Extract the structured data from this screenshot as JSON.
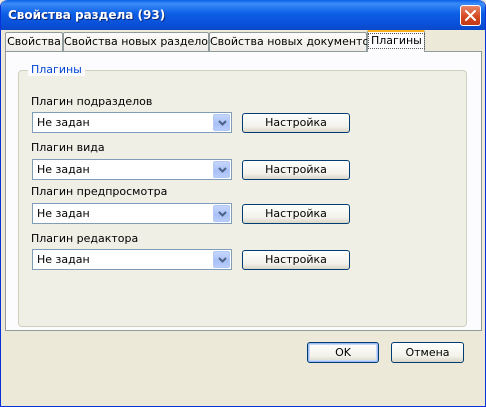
{
  "window": {
    "title": "Свойства раздела (93)"
  },
  "tabs": [
    {
      "label": "Свойства"
    },
    {
      "label": "Свойства новых разделов"
    },
    {
      "label": "Свойства новых документов"
    },
    {
      "label": "Плагины",
      "active": true
    }
  ],
  "group": {
    "title": "Плагины",
    "fields": [
      {
        "label": "Плагин подразделов",
        "value": "Не задан",
        "button": "Настройка"
      },
      {
        "label": "Плагин вида",
        "value": "Не задан",
        "button": "Настройка"
      },
      {
        "label": "Плагин предпросмотра",
        "value": "Не задан",
        "button": "Настройка"
      },
      {
        "label": "Плагин редактора",
        "value": "Не задан",
        "button": "Настройка"
      }
    ]
  },
  "buttons": {
    "ok": "OK",
    "cancel": "Отмена"
  },
  "icons": {
    "close": "close-icon",
    "dropdown": "chevron-down-icon"
  },
  "colors": {
    "titlebar": "#0a5fe8",
    "accent_tab": "#f7b21e",
    "group_title": "#0046d5"
  }
}
